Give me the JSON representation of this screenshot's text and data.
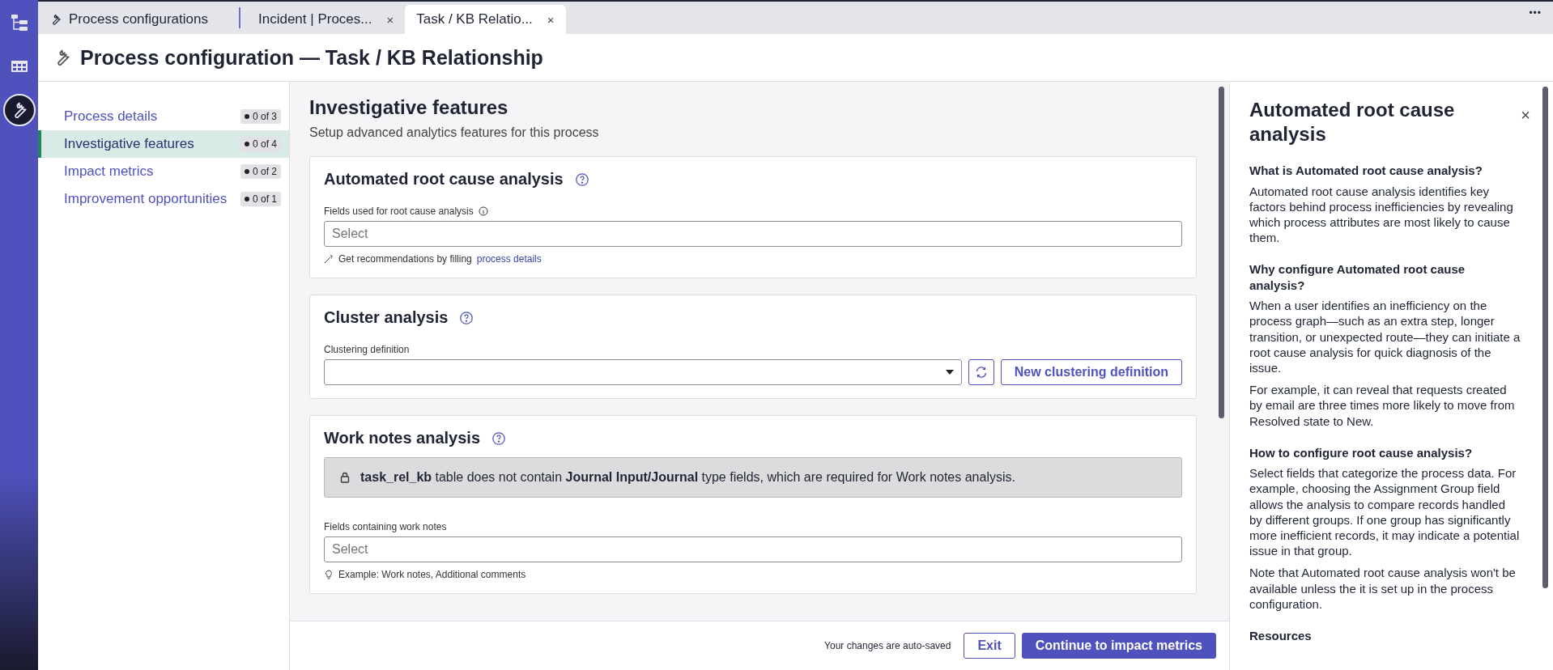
{
  "rail": {
    "items": [
      {
        "kind": "tree",
        "selected": false
      },
      {
        "kind": "table",
        "selected": false
      },
      {
        "kind": "wrench",
        "selected": true
      }
    ]
  },
  "tabs": [
    {
      "label": "Process configurations",
      "kind": "home",
      "selected": false
    },
    {
      "label": "Incident | Proces...",
      "kind": "document",
      "close": "×",
      "selected": false
    },
    {
      "label": "Task / KB Relatio...",
      "kind": "document",
      "close": "×",
      "selected": true
    }
  ],
  "tab_menu": "•••",
  "page_title": "Process configuration — Task / KB Relationship",
  "nav": [
    {
      "label": "Process details",
      "badge": "0 of 3",
      "selected": false
    },
    {
      "label": "Investigative features",
      "badge": "0 of 4",
      "selected": true
    },
    {
      "label": "Impact metrics",
      "badge": "0 of 2",
      "selected": false
    },
    {
      "label": "Improvement opportunities",
      "badge": "0 of 1",
      "selected": false
    }
  ],
  "main": {
    "title": "Investigative features",
    "subtitle": "Setup advanced analytics features for this process",
    "sections": [
      {
        "kind": "fields",
        "title": "Automated root cause analysis",
        "field_label": "Fields used for root cause analysis",
        "placeholder": "Select",
        "hint": "Get recommendations by filling",
        "hint_link": "process details"
      },
      {
        "kind": "clustering",
        "title": "Cluster analysis",
        "field_label": "Clustering definition",
        "button": "New clustering definition"
      },
      {
        "kind": "worknotes",
        "title": "Work notes analysis",
        "alert": "**task_rel_kb** table does not contain **Journal Input/Journal** type fields, which are required for Work notes analysis.",
        "field_label": "Fields containing work notes",
        "placeholder": "Select",
        "hint": "Example: Work notes, Additional comments"
      }
    ]
  },
  "footer": {
    "note": "Your changes are auto-saved",
    "exit": "Exit",
    "continue": "Continue to impact metrics"
  },
  "help_panel": {
    "title": "Automated root cause analysis",
    "close": "×",
    "sections": [
      {
        "heading": "What is Automated root cause analysis?",
        "paragraphs": [
          "Automated root cause analysis identifies key factors behind process inefficiencies by revealing which process attributes are most likely to cause them."
        ]
      },
      {
        "heading": "Why configure Automated root cause analysis?",
        "paragraphs": [
          "When a user identifies an inefficiency on the process graph—such as an extra step, longer transition, or unexpected route—they can initiate a root cause analysis for quick diagnosis of the issue.",
          "For example, it can reveal that requests created by email are three times more likely to move from Resolved state to New."
        ]
      },
      {
        "heading": "How to configure root cause analysis?",
        "paragraphs": [
          "Select fields that categorize the process data. For example, choosing the Assignment Group field allows the analysis to compare records handled by different groups. If one group has significantly more inefficient records, it may indicate a potential issue in that group.",
          "Note that Automated root cause analysis won't be available unless the it is set up in the process configuration."
        ]
      },
      {
        "heading": "Resources"
      }
    ]
  }
}
